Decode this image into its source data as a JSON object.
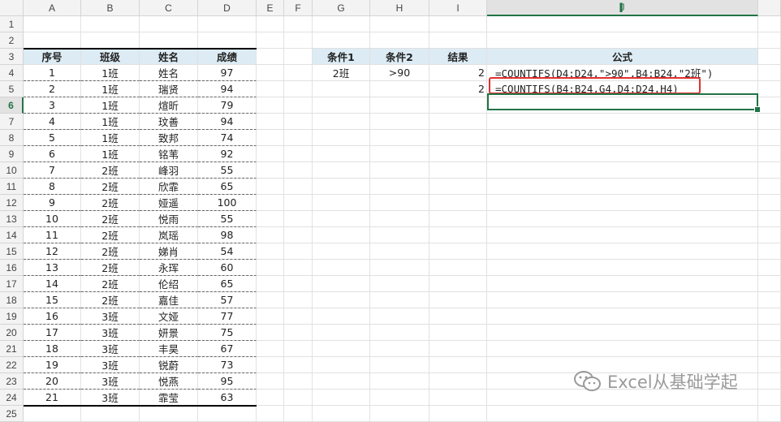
{
  "columns": [
    "A",
    "B",
    "C",
    "D",
    "E",
    "F",
    "G",
    "H",
    "I",
    "J"
  ],
  "rows": [
    "1",
    "2",
    "3",
    "4",
    "5",
    "6",
    "7",
    "8",
    "9",
    "10",
    "11",
    "12",
    "13",
    "14",
    "15",
    "16",
    "17",
    "18",
    "19",
    "20",
    "21",
    "22",
    "23",
    "24",
    "25"
  ],
  "table": {
    "headers": [
      "序号",
      "班级",
      "姓名",
      "成绩"
    ],
    "rows": [
      [
        "1",
        "1班",
        "姓名",
        "97"
      ],
      [
        "2",
        "1班",
        "瑞贤",
        "94"
      ],
      [
        "3",
        "1班",
        "煊昕",
        "79"
      ],
      [
        "4",
        "1班",
        "玟善",
        "94"
      ],
      [
        "5",
        "1班",
        "致邦",
        "74"
      ],
      [
        "6",
        "1班",
        "铭苇",
        "92"
      ],
      [
        "7",
        "2班",
        "峰羽",
        "55"
      ],
      [
        "8",
        "2班",
        "欣霏",
        "65"
      ],
      [
        "9",
        "2班",
        "娅遥",
        "100"
      ],
      [
        "10",
        "2班",
        "悦雨",
        "55"
      ],
      [
        "11",
        "2班",
        "岚瑶",
        "98"
      ],
      [
        "12",
        "2班",
        "娣肖",
        "54"
      ],
      [
        "13",
        "2班",
        "永珲",
        "60"
      ],
      [
        "14",
        "2班",
        "伦绍",
        "65"
      ],
      [
        "15",
        "2班",
        "嘉佳",
        "57"
      ],
      [
        "16",
        "3班",
        "文娅",
        "77"
      ],
      [
        "17",
        "3班",
        "妍景",
        "75"
      ],
      [
        "18",
        "3班",
        "丰昊",
        "67"
      ],
      [
        "19",
        "3班",
        "锐蔚",
        "73"
      ],
      [
        "20",
        "3班",
        "悦燕",
        "95"
      ],
      [
        "21",
        "3班",
        "霏莹",
        "63"
      ]
    ]
  },
  "criteria": {
    "headers": [
      "条件1",
      "条件2",
      "结果",
      "公式"
    ],
    "cond1": "2班",
    "cond2": ">90",
    "result1": "2",
    "result2": "2",
    "formula1": "=COUNTIFS(D4:D24,\">90\",B4:B24,\"2班\")",
    "formula2": "=COUNTIFS(B4:B24,G4,D4:D24,H4)"
  },
  "selection": {
    "active_column": "J",
    "active_row": "6"
  },
  "watermark": {
    "text": "Excel从基础学起",
    "icon": "wechat-icon"
  }
}
